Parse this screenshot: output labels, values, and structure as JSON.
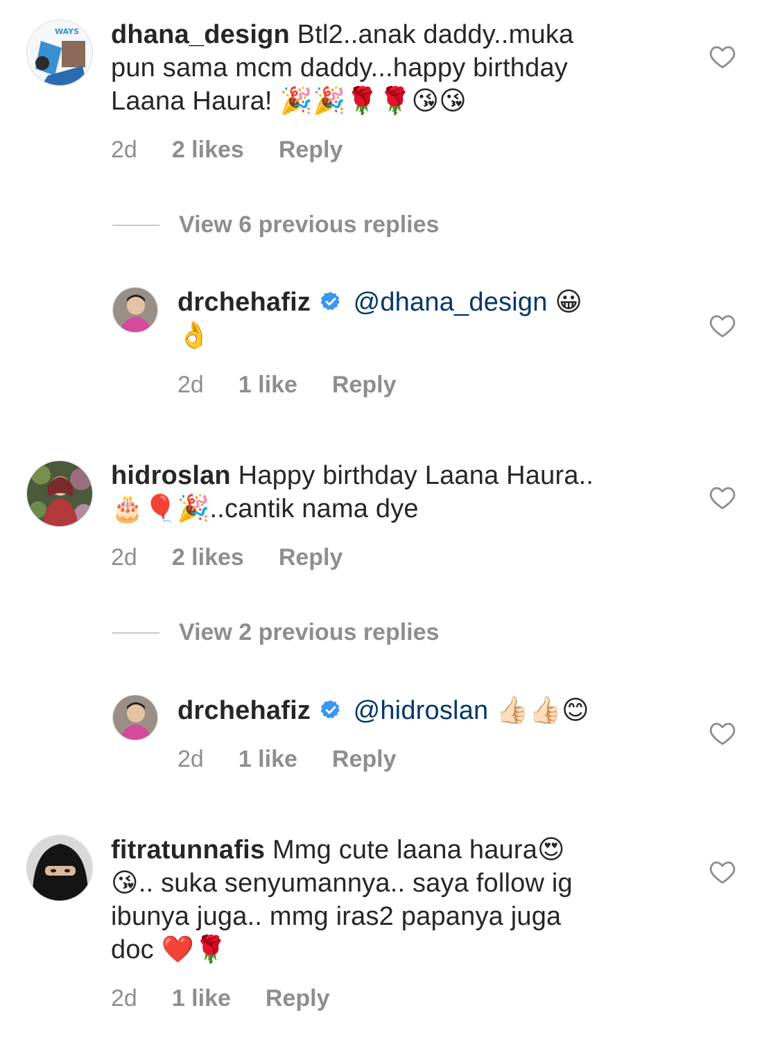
{
  "comments": [
    {
      "username": "dhana_design",
      "text_lines": [
        "Btl2..anak daddy..muka",
        "pun sama mcm daddy...happy birthday",
        "Laana Haura! 🎉🎉🌹🌹😘😘"
      ],
      "time": "2d",
      "likes": "2 likes",
      "reply": "Reply",
      "avatar_text": "WAYS"
    },
    {
      "view_replies": "View 6 previous replies",
      "username": "drchehafiz",
      "mention": "@dhana_design",
      "text_lines": [
        "😀",
        "👌"
      ],
      "time": "2d",
      "likes": "1 like",
      "reply": "Reply"
    },
    {
      "username": "hidroslan",
      "text_lines": [
        "Happy birthday Laana Haura..",
        "🎂🎈🎉..cantik nama dye"
      ],
      "time": "2d",
      "likes": "2 likes",
      "reply": "Reply"
    },
    {
      "view_replies": "View 2 previous replies",
      "username": "drchehafiz",
      "mention": "@hidroslan",
      "text_lines": [
        "👍🏻👍🏻😊"
      ],
      "time": "2d",
      "likes": "1 like",
      "reply": "Reply"
    },
    {
      "username": "fitratunnafis",
      "text_lines": [
        "Mmg cute laana haura😍",
        "😘.. suka senyumannya.. saya follow ig",
        "ibunya juga.. mmg iras2 papanya juga",
        "doc ❤️🌹"
      ],
      "time": "2d",
      "likes": "1 like",
      "reply": "Reply"
    }
  ],
  "colors": {
    "text": "#262626",
    "muted": "#8e8e8e",
    "mention": "#00376b",
    "verified": "#3897f0"
  },
  "icons": {
    "like": "heart-icon",
    "verified": "verified-badge-icon"
  }
}
